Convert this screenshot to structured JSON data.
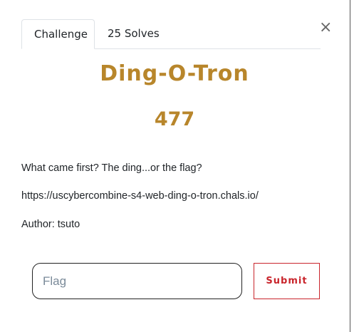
{
  "tabs": [
    {
      "label": "Challenge",
      "active": true
    },
    {
      "label": "25 Solves",
      "active": false
    }
  ],
  "close_label": "×",
  "challenge": {
    "name": "Ding-O-Tron",
    "points": "477",
    "description": "What came first? The ding...or the flag?",
    "url": "https://uscybercombine-s4-web-ding-o-tron.chals.io/",
    "author": "Author: tsuto"
  },
  "form": {
    "flag_placeholder": "Flag",
    "flag_value": "",
    "submit_label": "Submit"
  },
  "colors": {
    "accent": "#b8862b",
    "submit": "#c9252c"
  }
}
